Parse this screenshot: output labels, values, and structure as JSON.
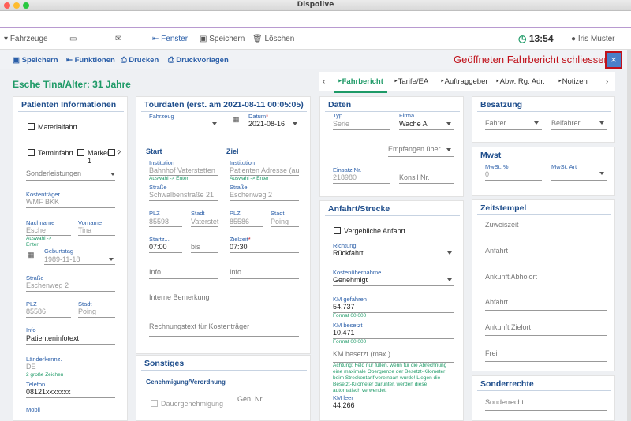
{
  "window": {
    "title": "Dispolive"
  },
  "toolbar": {
    "vehicles": "Fahrzeuge",
    "window": "Fenster",
    "save": "Speichern",
    "delete": "Löschen",
    "clock": "13:54",
    "user": "Iris Muster"
  },
  "actions": {
    "save": "Speichern",
    "functions": "Funktionen",
    "print": "Drucken",
    "templates": "Druckvorlagen",
    "close_message": "Geöffneten Fahrbericht schliessen!",
    "close_icon": "×"
  },
  "patient_header": "Esche Tina/Alter: 31 Jahre",
  "tabs": [
    "Fahrbericht",
    "Tarife/EA",
    "Auftraggeber",
    "Abw. Rg. Adr.",
    "Notizen"
  ],
  "patient": {
    "title": "Patienten Informationen",
    "materialfahrt": "Materialfahrt",
    "terminfahrt": "Terminfahrt",
    "marker": "Marker",
    "marker_num": "1",
    "q": "?",
    "sonderleistungen": "Sonderleistungen",
    "kostentraeger_label": "Kostenträger",
    "kostentraeger": "WMF BKK",
    "nachname_label": "Nachname",
    "nachname": "Esche",
    "vorname_label": "Vorname",
    "vorname": "Tina",
    "auswahl_enter": "Auswahl ->",
    "enter": "Enter",
    "geburtstag_label": "Geburtstag",
    "geburtstag": "1989-11-18",
    "strasse_label": "Straße",
    "strasse": "Eschenweg 2",
    "plz_label": "PLZ",
    "plz": "85586",
    "stadt_label": "Stadt",
    "stadt": "Poing",
    "info_label": "Info",
    "info": "Patienteninfotext",
    "laender_label": "Länderkennz.",
    "laender": "DE",
    "laender_note": "2 große Zeichen",
    "telefon_label": "Telefon",
    "telefon": "08121xxxxxxx",
    "mobil_label": "Mobil"
  },
  "tour": {
    "title": "Tourdaten (erst. am 2021-08-11 00:05:05)",
    "fahrzeug": "Fahrzeug",
    "datum_label": "Datum",
    "datum": "2021-08-16",
    "start": "Start",
    "ziel": "Ziel",
    "institution_label": "Institution",
    "start_institution": "Bahnhof Vaterstetten",
    "ziel_institution": "Patienten Adresse (au",
    "auswahl": "Auswahl -> Enter",
    "strasse_label": "Straße",
    "start_strasse": "Schwalbenstraße 21",
    "ziel_strasse": "Eschenweg 2",
    "plz_label": "PLZ",
    "stadt_label": "Stadt",
    "start_plz": "85598",
    "start_stadt": "Vaterstet",
    "ziel_plz": "85586",
    "ziel_stadt": "Poing",
    "startzeit_label": "Startz...",
    "startzeit": "07:00",
    "bis": "bis",
    "zielzeit_label": "Zielzeit",
    "zielzeit": "07:30",
    "info": "Info",
    "info2": "Info",
    "interne": "Interne Bemerkung",
    "rechnung": "Rechnungstext für Kostenträger"
  },
  "sonstiges": {
    "title": "Sonstiges",
    "genehmigung": "Genehmigung/Verordnung",
    "dauer": "Dauergenehmigung",
    "gen_nr": "Gen. Nr."
  },
  "daten": {
    "title": "Daten",
    "typ_label": "Typ",
    "typ": "Serie",
    "firma_label": "Firma",
    "firma": "Wache A",
    "empfangen": "Empfangen über",
    "einsatz_label": "Einsatz Nr.",
    "einsatz": "218980",
    "konsil": "Konsil Nr."
  },
  "anfahrt": {
    "title": "Anfahrt/Strecke",
    "vergleich": "Vergebliche Anfahrt",
    "richtung_label": "Richtung",
    "richtung": "Rückfahrt",
    "kosten_label": "Kostenübernahme",
    "kosten": "Genehmigt",
    "km_gef_label": "KM gefahren",
    "km_gef": "54,737",
    "format": "Format 00,000",
    "km_bes_label": "KM besetzt",
    "km_bes": "10,471",
    "format2": "Format 00,000",
    "km_max": "KM besetzt (max.)",
    "note": "Achtung: Feld nur füllen, wenn für die Abrechnung eine maximale Obergrenze der Besetzt-Kilometer beim Streckentarif vereinbart wurde! Liegen die Besetzt-Kilometer darunter, werden diese automatisch verwendet.",
    "km_leer_label": "KM leer",
    "km_leer": "44,266"
  },
  "besatzung": {
    "title": "Besatzung",
    "fahrer": "Fahrer",
    "beifahrer": "Beifahrer"
  },
  "mwst": {
    "title": "Mwst",
    "pct_label": "MwSt. %",
    "pct": "0",
    "art_label": "MwSt. Art"
  },
  "zeit": {
    "title": "Zeitstempel",
    "items": [
      "Zuweiszeit",
      "Anfahrt",
      "Ankunft Abholort",
      "Abfahrt",
      "Ankunft Zielort",
      "Frei"
    ]
  },
  "sonderrechte": {
    "title": "Sonderrechte",
    "item": "Sonderrecht"
  },
  "colors": {
    "accent": "#1e9a67",
    "brand": "#1f4e8c",
    "danger": "#c0111a"
  }
}
